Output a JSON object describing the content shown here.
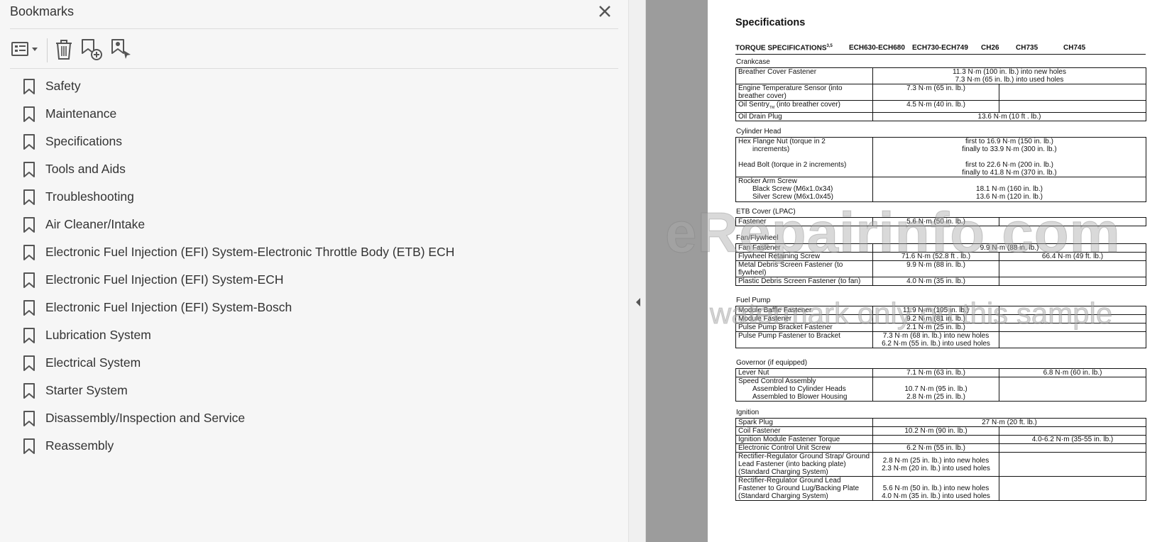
{
  "sidebar": {
    "title": "Bookmarks",
    "close_icon": "close-icon",
    "toolbar": {
      "options_icon": "bookmark-options-icon",
      "delete_icon": "trash-icon",
      "new_bookmark_icon": "new-bookmark-icon",
      "find_bookmark_icon": "find-current-bookmark-icon"
    },
    "bookmarks": [
      "Safety",
      "Maintenance",
      "Specifications",
      "Tools and Aids",
      "Troubleshooting",
      "Air Cleaner/Intake",
      "Electronic Fuel Injection (EFI) System-Electronic Throttle Body (ETB) ECH",
      "Electronic Fuel Injection (EFI) System-ECH",
      "Electronic Fuel Injection (EFI) System-Bosch",
      "Lubrication System",
      "Electrical System",
      "Starter System",
      "Disassembly/Inspection and Service",
      "Reassembly"
    ]
  },
  "viewer": {
    "collapse_icon": "collapse-panel-icon",
    "watermark": "eRepairinfo.com",
    "watermark_sub": "watermark only on this sample"
  },
  "doc": {
    "title": "Specifications",
    "header": {
      "torque": "TORQUE SPECIFICATIONS",
      "torque_sup": "3,5",
      "col1": "ECH630-ECH680",
      "col2": "ECH730-ECH749",
      "col3": "CH26",
      "col4": "CH735",
      "col5": "CH745"
    },
    "crankcase": {
      "label": "Crankcase",
      "breather_label": "Breather Cover Fastener",
      "breather_v1": "11.3 N·m (100 in. lb.) into new holes",
      "breather_v2": "7.3 N·m (65 in. lb.) into used holes",
      "temp_label": "Engine Temperature Sensor (into breather cover)",
      "temp_v": "7.3 N·m (65 in. lb.)",
      "sentry_label": "Oil Sentry",
      "sentry_tm": "TM",
      "sentry_label2": " (into breather cover)",
      "sentry_v": "4.5 N·m (40 in. lb.)",
      "drain_label": "Oil Drain Plug",
      "drain_v": "13.6 N·m (10 ft . lb.)"
    },
    "cylinder": {
      "label": "Cylinder Head",
      "hex_label1": "Hex Flange Nut (torque in 2",
      "hex_label2": "increments)",
      "hex_v1": "first to 16.9 N·m (150 in. lb.)",
      "hex_v2": "finally to 33.9 N·m (300 in. lb.)",
      "bolt_label": "Head Bolt (torque in 2 increments)",
      "bolt_v1": "first to 22.6 N·m (200 in. lb.)",
      "bolt_v2": "finally to 41.8 N·m (370 in. lb.)",
      "rocker_label": "Rocker Arm Screw",
      "black_label": "Black Screw (M6x1.0x34)",
      "silver_label": "Silver Screw (M6x1.0x45)",
      "black_v": "18.1 N·m (160 in. lb.)",
      "silver_v": "13.6 N·m (120 in. lb.)"
    },
    "etb": {
      "label": "ETB Cover (LPAC)",
      "fastener_label": "Fastener",
      "fastener_v": "5.6 N·m (50 in. lb.)"
    },
    "fan": {
      "label": "Fan/Flywheel",
      "fan_label": "Fan Fastener",
      "fan_v": "9.9 N·m (88 in. lb.)",
      "fly_label": "Flywheel Retaining Screw",
      "fly_v1": "71.6 N·m (52.8 ft . lb.)",
      "fly_v2": "66.4 N·m (49 ft. lb.)",
      "metal_label": "Metal Debris Screen Fastener (to flywheel)",
      "metal_v": "9.9 N·m (88 in. lb.)",
      "plastic_label": "Plastic Debris Screen Fastener (to fan)",
      "plastic_v": "4.0 N·m (35 in. lb.)"
    },
    "fuel": {
      "label": "Fuel Pump",
      "baffle_label": "Module Baffle Fastener",
      "baffle_v": "11.9 N·m (105 in. lb.)",
      "module_label": "Module Fastener",
      "module_v": "9.2 N·m (81 in. lb.)",
      "bracket_label": "Pulse Pump Bracket Fastener",
      "bracket_v": "2.1 N·m (25 in. lb.)",
      "pulse_label": "Pulse Pump Fastener to Bracket",
      "pulse_v1": "7.3 N·m (68 in. lb.) into new holes",
      "pulse_v2": "6.2 N·m (55 in. lb.) into used holes"
    },
    "governor": {
      "label": "Governor (if equipped)",
      "lever_label": "Lever Nut",
      "lever_v1": "7.1 N·m (63 in. lb.)",
      "lever_v2": "6.8 N·m (60 in. lb.)",
      "speed_label": "Speed Control Assembly",
      "cyl_label": "Assembled to Cylinder Heads",
      "blower_label": "Assembled to Blower Housing",
      "cyl_v": "10.7 N·m (95 in. lb.)",
      "blower_v": "2.8 N·m (25 in. lb.)"
    },
    "ignition": {
      "label": "Ignition",
      "spark_label": "Spark Plug",
      "spark_v": "27 N·m (20 ft. lb.)",
      "coil_label": "Coil Fastener",
      "coil_v": "10.2 N·m (90 in. lb.)",
      "module_label": "Ignition Module Fastener Torque",
      "module_v": "4.0-6.2 N·m (35-55 in. lb.)",
      "ecu_label": "Electronic Control Unit Screw",
      "ecu_v": "6.2 N·m (55 in. lb.)",
      "rect1_label": "Rectifier-Regulator Ground Strap/ Ground Lead Fastener (into backing plate) (Standard Charging System)",
      "rect1_v1": "2.8 N·m (25 in. lb.) into new holes",
      "rect1_v2": "2.3 N·m (20 in. lb.) into used holes",
      "rect2_label": "Rectifier-Regulator Ground Lead Fastener to Ground Lug/Backing Plate (Standard Charging System)",
      "rect2_v1": "5.6 N·m (50 in. lb.) into new holes",
      "rect2_v2": "4.0 N·m (35 in. lb.) into used holes"
    }
  }
}
